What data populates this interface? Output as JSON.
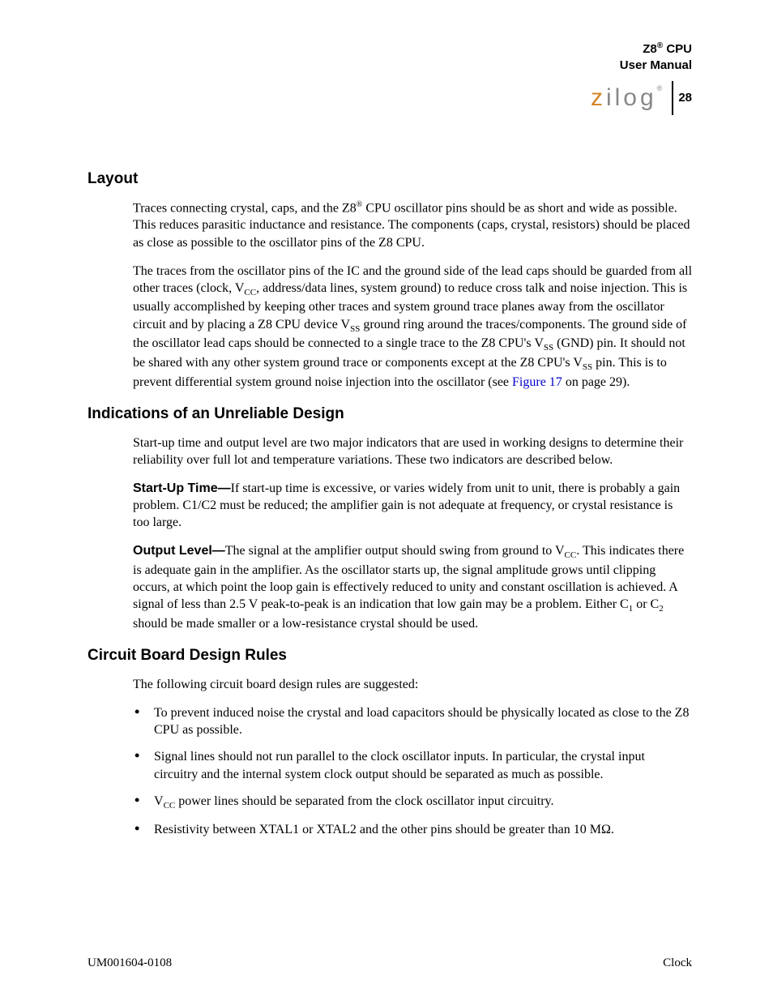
{
  "header": {
    "product_line1": "Z8",
    "product_sup": "®",
    "product_line1b": " CPU",
    "product_line2": "User Manual",
    "logo_z": "z",
    "logo_rest": "ilog",
    "logo_reg": "®",
    "page_number": "28"
  },
  "sections": {
    "layout": {
      "heading": "Layout",
      "p1a": "Traces connecting crystal, caps, and the Z8",
      "p1sup": "®",
      "p1b": " CPU oscillator pins should be as short and wide as possible. This reduces parasitic inductance and resistance. The components (caps, crystal, resistors) should be placed as close as possible to the oscillator pins of the Z8 CPU.",
      "p2a": "The traces from the oscillator pins of the IC and the ground side of the lead caps should be guarded from all other traces (clock, V",
      "p2sub1": "CC",
      "p2b": ", address/data lines, system ground) to reduce cross talk and noise injection. This is usually accomplished by keeping other traces and system ground trace planes away from the oscillator circuit and by placing a Z8 CPU device V",
      "p2sub2": "SS",
      "p2c": " ground ring around the traces/components. The ground side of the oscillator lead caps should be connected to a single trace to the Z8 CPU's V",
      "p2sub3": "SS",
      "p2d": " (GND) pin. It should not be shared with any other system ground trace or components except at the Z8 CPU's V",
      "p2sub4": "SS",
      "p2e": " pin. This is to prevent differential system ground noise injection into the oscillator (see ",
      "p2link": "Figure 17",
      "p2f": " on page 29)."
    },
    "unreliable": {
      "heading": "Indications of an Unreliable Design",
      "p1": "Start-up time and output level are two major indicators that are used in working designs to determine their reliability over full lot and temperature variations. These two indicators are described below.",
      "p2label": "Start-Up Time—",
      "p2": "If start-up time is excessive, or varies widely from unit to unit, there is probably a gain problem. C1/C2 must be reduced; the amplifier gain is not adequate at frequency, or crystal resistance is too large.",
      "p3label": "Output Level—",
      "p3a": "The signal at the amplifier output should swing from ground to V",
      "p3sub1": "CC",
      "p3b": ". This indicates there is adequate gain in the amplifier. As the oscillator starts up, the signal amplitude grows until clipping occurs, at which point the loop gain is effectively reduced to unity and constant oscillation is achieved. A signal of less than 2.5 V peak-to-peak is an indication that low gain may be a problem. Either C",
      "p3sub2": "1",
      "p3c": " or C",
      "p3sub3": "2",
      "p3d": " should be made smaller or a low-resistance crystal should be used."
    },
    "circuit": {
      "heading": "Circuit Board Design Rules",
      "intro": "The following circuit board design rules are suggested:",
      "bullets": {
        "b1": "To prevent induced noise the crystal and load capacitors should be physically located as close to the Z8 CPU as possible.",
        "b2": "Signal lines should not run parallel to the clock oscillator inputs. In particular, the crystal input circuitry and the internal system clock output should be separated as much as possible.",
        "b3a": "V",
        "b3sub": "CC",
        "b3b": " power lines should be separated from the clock oscillator input circuitry.",
        "b4": "Resistivity between XTAL1 or XTAL2 and the other pins should be greater than 10 MΩ."
      }
    }
  },
  "footer": {
    "left": "UM001604-0108",
    "right": "Clock"
  }
}
